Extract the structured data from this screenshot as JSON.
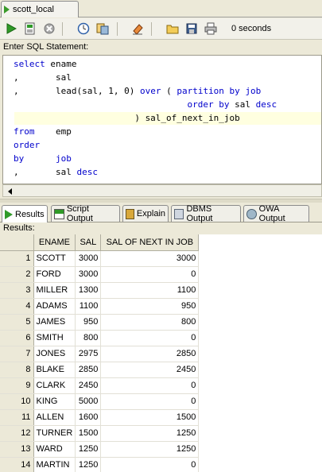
{
  "tab": {
    "label": "scott_local"
  },
  "toolbar": {
    "elapsed": "0 seconds",
    "buttons": [
      "run-statement",
      "run-script",
      "cancel",
      "autotrace",
      "explain-plan",
      "clear",
      "open-file",
      "save",
      "print"
    ]
  },
  "sql": {
    "label": "Enter SQL Statement:",
    "lines": [
      [
        [
          "kw",
          "select"
        ],
        [
          "t",
          " ename"
        ]
      ],
      [
        [
          "t",
          ",       sal"
        ]
      ],
      [
        [
          "t",
          ",       lead(sal, 1, 0) "
        ],
        [
          "kw",
          "over"
        ],
        [
          "t",
          " ( "
        ],
        [
          "kw",
          "partition by"
        ],
        [
          "t",
          " "
        ],
        [
          "kw",
          "job"
        ]
      ],
      [
        [
          "t",
          "                                 "
        ],
        [
          "kw",
          "order by"
        ],
        [
          "t",
          " sal "
        ],
        [
          "kw",
          "desc"
        ]
      ],
      [
        [
          "t",
          "                       ) sal_of_next_in_job"
        ]
      ],
      [
        [
          "kw",
          "from"
        ],
        [
          "t",
          "    emp"
        ]
      ],
      [
        [
          "kw",
          "order"
        ]
      ],
      [
        [
          "kw",
          "by"
        ],
        [
          "t",
          "      "
        ],
        [
          "kw",
          "job"
        ]
      ],
      [
        [
          "t",
          ",       sal "
        ],
        [
          "kw",
          "desc"
        ]
      ]
    ]
  },
  "result_tabs": [
    {
      "label": "Results",
      "icon": "run-icon",
      "active": true
    },
    {
      "label": "Script Output",
      "icon": "script-icon",
      "active": false
    },
    {
      "label": "Explain",
      "icon": "explain-icon",
      "active": false
    },
    {
      "label": "DBMS Output",
      "icon": "dbms-icon",
      "active": false
    },
    {
      "label": "OWA Output",
      "icon": "owa-icon",
      "active": false
    }
  ],
  "results": {
    "label": "Results:",
    "columns": [
      "ENAME",
      "SAL",
      "SAL OF NEXT IN JOB"
    ],
    "rows": [
      [
        "1",
        "SCOTT",
        "3000",
        "3000"
      ],
      [
        "2",
        "FORD",
        "3000",
        "0"
      ],
      [
        "3",
        "MILLER",
        "1300",
        "1100"
      ],
      [
        "4",
        "ADAMS",
        "1100",
        "950"
      ],
      [
        "5",
        "JAMES",
        "950",
        "800"
      ],
      [
        "6",
        "SMITH",
        "800",
        "0"
      ],
      [
        "7",
        "JONES",
        "2975",
        "2850"
      ],
      [
        "8",
        "BLAKE",
        "2850",
        "2450"
      ],
      [
        "9",
        "CLARK",
        "2450",
        "0"
      ],
      [
        "10",
        "KING",
        "5000",
        "0"
      ],
      [
        "11",
        "ALLEN",
        "1600",
        "1500"
      ],
      [
        "12",
        "TURNER",
        "1500",
        "1250"
      ],
      [
        "13",
        "WARD",
        "1250",
        "1250"
      ],
      [
        "14",
        "MARTIN",
        "1250",
        "0"
      ]
    ]
  }
}
